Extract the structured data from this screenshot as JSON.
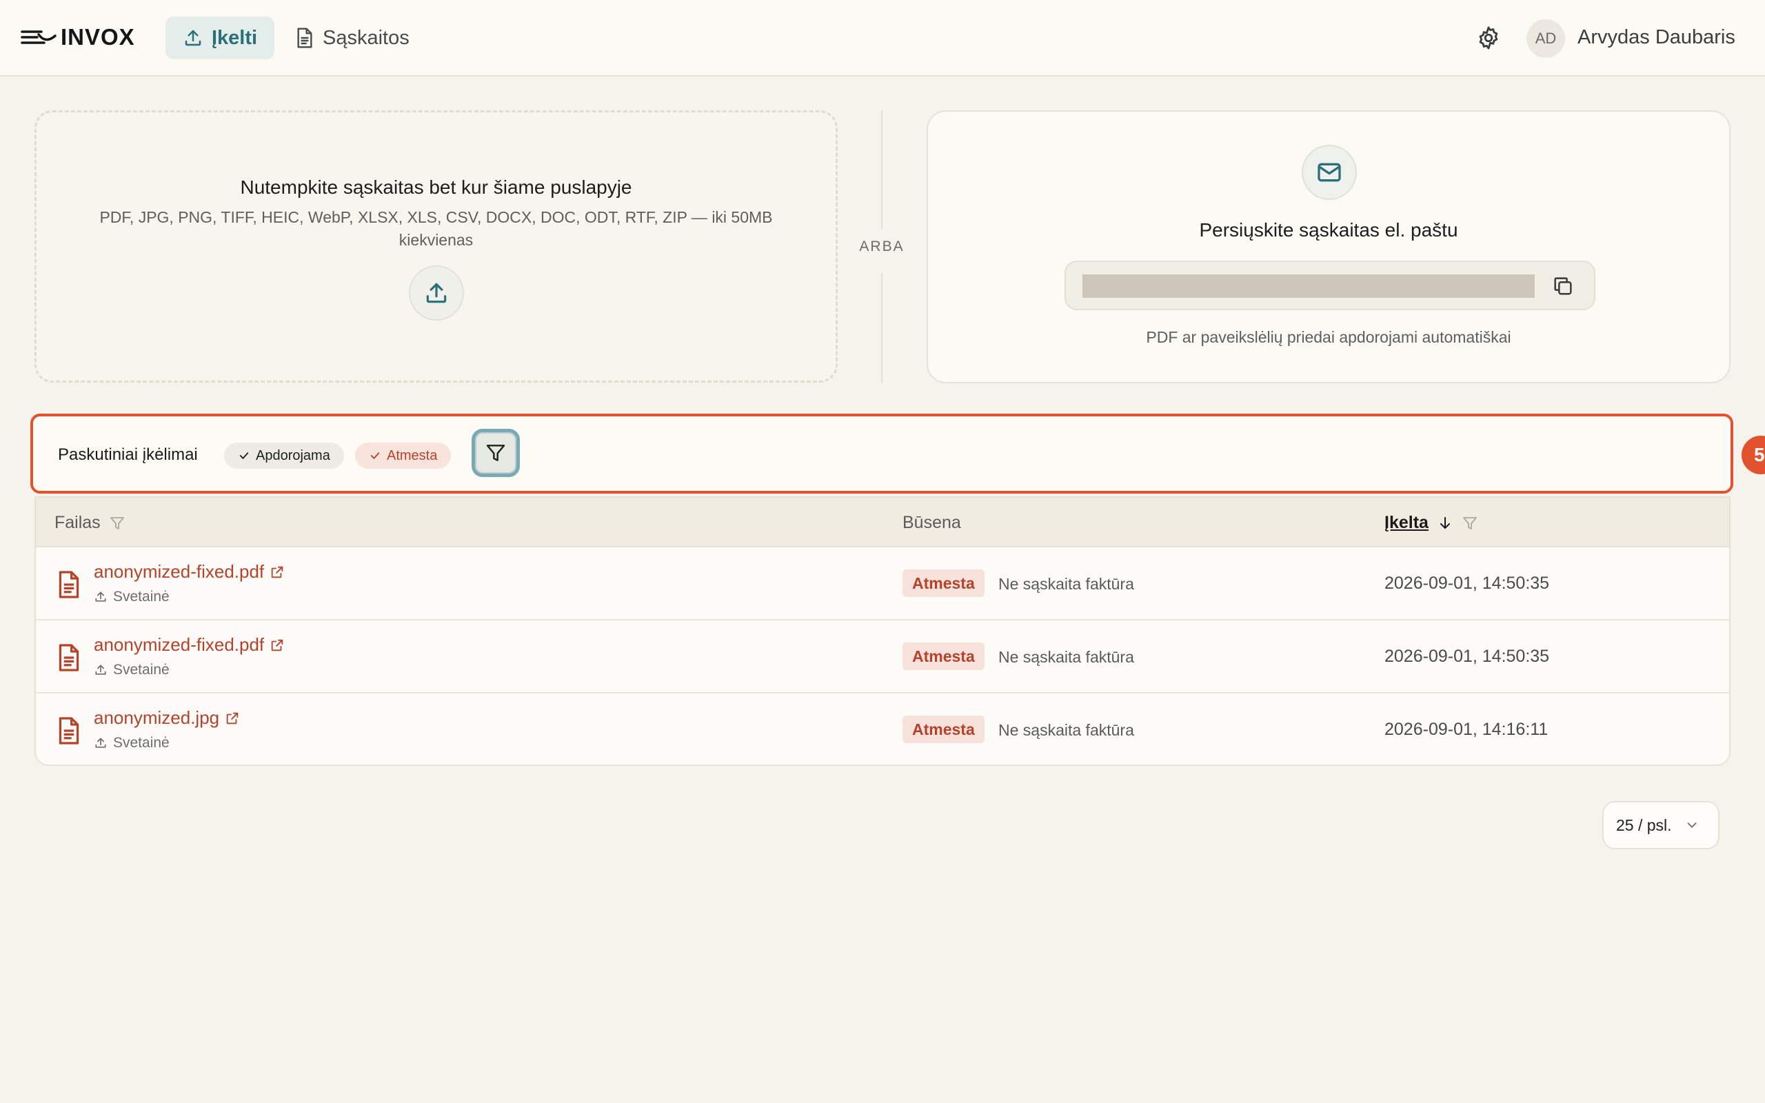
{
  "header": {
    "brand": "INVOX",
    "nav": {
      "upload_label": "Įkelti",
      "invoices_label": "Sąskaitos"
    },
    "user": {
      "initials": "AD",
      "name": "Arvydas Daubaris"
    }
  },
  "dropzone": {
    "title": "Nutempkite sąskaitas bet kur šiame puslapyje",
    "subtitle": "PDF, JPG, PNG, TIFF, HEIC, WebP, XLSX, XLS, CSV, DOCX, DOC, ODT, RTF, ZIP — iki 50MB kiekvienas"
  },
  "separator": "ARBA",
  "email": {
    "title": "Persiųskite sąskaitas el. paštu",
    "note": "PDF ar paveikslėlių priedai apdorojami automatiškai"
  },
  "recent": {
    "title": "Paskutiniai įkėlimai",
    "chips": {
      "processing": "Apdorojama",
      "rejected": "Atmesta"
    },
    "step_badge": "5"
  },
  "table": {
    "columns": {
      "file": "Failas",
      "status": "Būsena",
      "uploaded": "Įkelta"
    },
    "rows": [
      {
        "file": "anonymized-fixed.pdf",
        "source": "Svetainė",
        "status": "Atmesta",
        "reason": "Ne sąskaita faktūra",
        "uploaded": "2026-09-01, 14:50:35"
      },
      {
        "file": "anonymized-fixed.pdf",
        "source": "Svetainė",
        "status": "Atmesta",
        "reason": "Ne sąskaita faktūra",
        "uploaded": "2026-09-01, 14:50:35"
      },
      {
        "file": "anonymized.jpg",
        "source": "Svetainė",
        "status": "Atmesta",
        "reason": "Ne sąskaita faktūra",
        "uploaded": "2026-09-01, 14:16:11"
      }
    ]
  },
  "pagination": {
    "page_size": "25 / psl."
  },
  "colors": {
    "accent": "#2a6f79",
    "rejected": "#b5432b",
    "highlight": "#e2522c"
  }
}
